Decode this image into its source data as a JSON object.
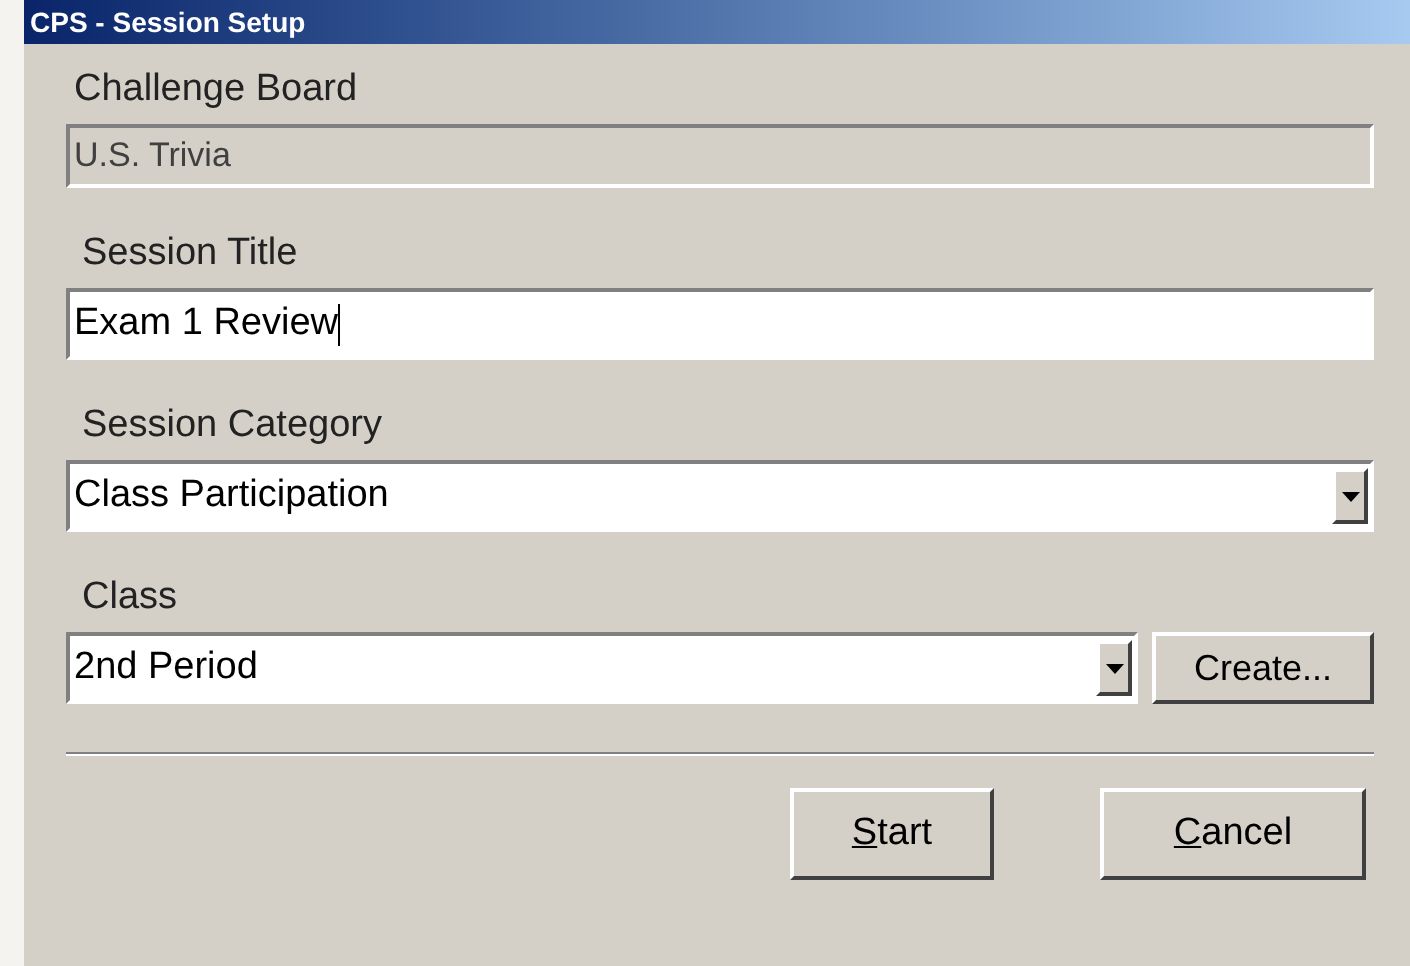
{
  "window": {
    "title": "CPS - Session Setup"
  },
  "fields": [
    {
      "kind": "readonly",
      "label": "Challenge Board",
      "value": "U.S. Trivia"
    },
    {
      "kind": "text",
      "label": "Session Title",
      "value": "Exam 1 Review",
      "focused": true
    },
    {
      "kind": "dropdown",
      "label": "Session Category",
      "value": "Class Participation"
    },
    {
      "kind": "dropdown",
      "label": "Class",
      "value": "2nd Period",
      "button": "Create..."
    }
  ],
  "buttons": [
    {
      "label": "Start",
      "underline_first": true
    },
    {
      "label": "Cancel",
      "underline_first": true
    }
  ]
}
